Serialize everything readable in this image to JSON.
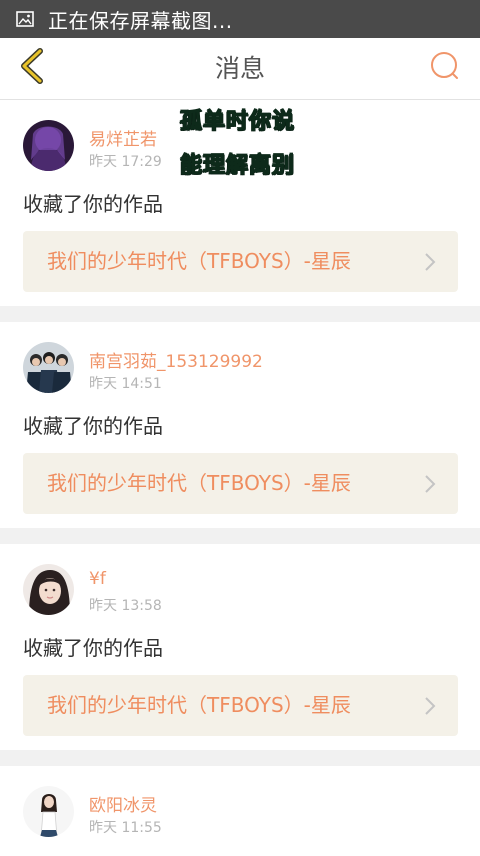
{
  "status_bar": {
    "text": "正在保存屏幕截图...",
    "icon": "image-icon"
  },
  "nav": {
    "title": "消息",
    "back_icon": "chevron-left-icon",
    "search_icon": "search-icon",
    "accent_color": "#f0956a",
    "back_color": "#e8c32a"
  },
  "overlay": {
    "line1": "孤单时你说",
    "line2": "能理解离别"
  },
  "messages": [
    {
      "username": "易烊芷若",
      "time": "昨天 17:29",
      "action": "收藏了你的作品",
      "work": "我们的少年时代（TFBOYS）-星辰"
    },
    {
      "username": "南宫羽茹_153129992",
      "time": "昨天 14:51",
      "action": "收藏了你的作品",
      "work": "我们的少年时代（TFBOYS）-星辰"
    },
    {
      "username": "¥f",
      "time": "昨天 13:58",
      "action": "收藏了你的作品",
      "work": "我们的少年时代（TFBOYS）-星辰"
    },
    {
      "username": "欧阳冰灵",
      "time": "昨天 11:55"
    }
  ]
}
